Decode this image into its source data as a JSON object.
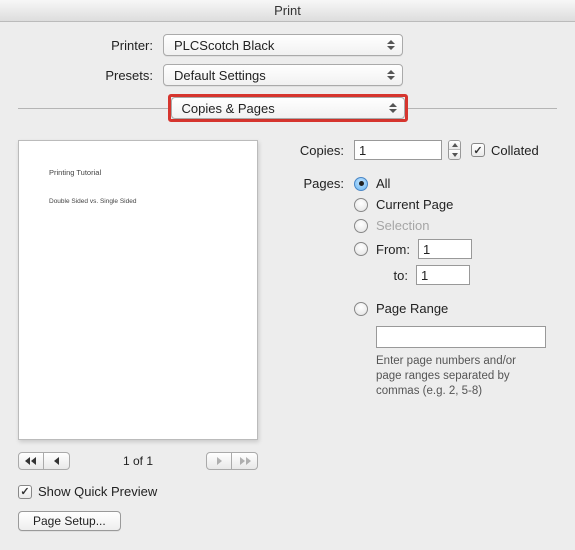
{
  "window": {
    "title": "Print"
  },
  "labels": {
    "printer": "Printer:",
    "presets": "Presets:",
    "copies": "Copies:",
    "pages": "Pages:",
    "collated": "Collated",
    "show_quick_preview": "Show Quick Preview",
    "page_setup": "Page Setup...",
    "from": "From:",
    "to": "to:"
  },
  "selects": {
    "printer_value": "PLCScotch Black",
    "presets_value": "Default Settings",
    "section_value": "Copies & Pages"
  },
  "copies": {
    "value": "1",
    "collated": true
  },
  "pages": {
    "selected": "all",
    "options": {
      "all": "All",
      "current": "Current Page",
      "selection": "Selection",
      "from": "From:",
      "page_range": "Page Range"
    },
    "from_value": "1",
    "to_value": "1",
    "range_value": "",
    "range_hint": "Enter page numbers and/or page ranges separated by commas (e.g. 2, 5-8)"
  },
  "preview": {
    "doc_title": "Printing Tutorial",
    "doc_sub": "Double Sided vs. Single Sided",
    "page_indicator": "1 of 1",
    "show_quick_preview": true
  }
}
